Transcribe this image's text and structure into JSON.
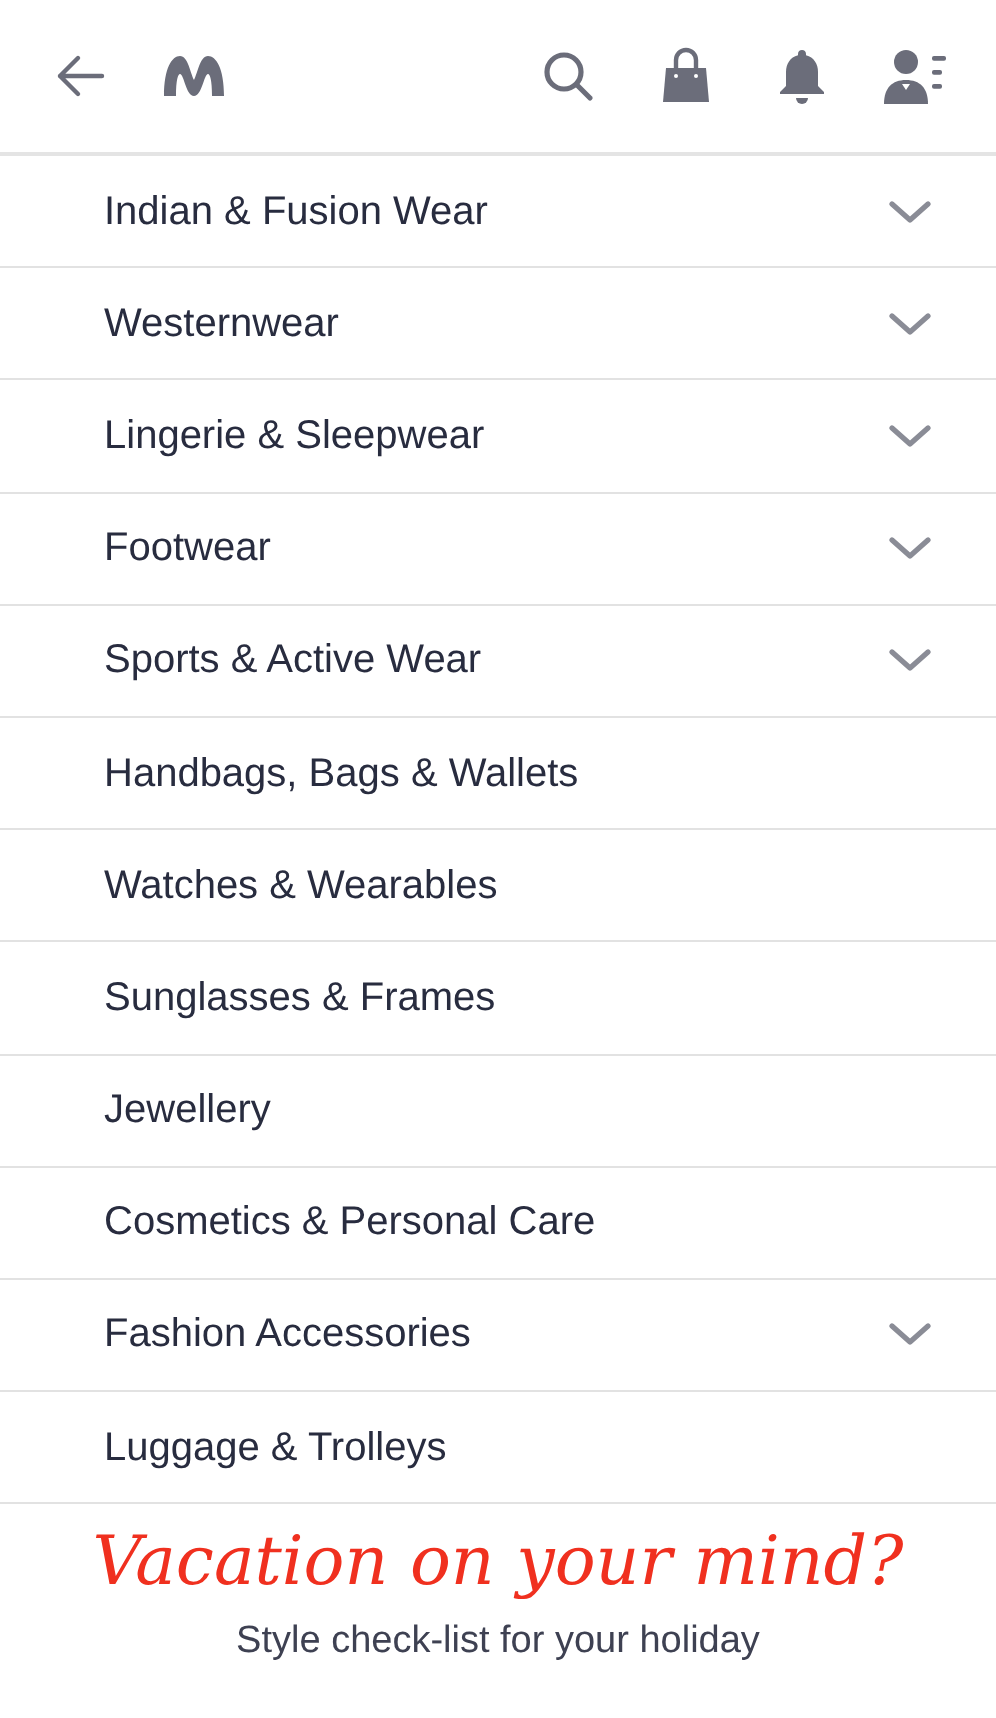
{
  "categories": [
    {
      "label": "Indian & Fusion Wear",
      "has_submenu": true
    },
    {
      "label": "Westernwear",
      "has_submenu": true
    },
    {
      "label": "Lingerie & Sleepwear",
      "has_submenu": true
    },
    {
      "label": "Footwear",
      "has_submenu": true
    },
    {
      "label": "Sports & Active Wear",
      "has_submenu": true
    },
    {
      "label": "Handbags, Bags & Wallets",
      "has_submenu": false
    },
    {
      "label": "Watches & Wearables",
      "has_submenu": false
    },
    {
      "label": "Sunglasses & Frames",
      "has_submenu": false
    },
    {
      "label": "Jewellery",
      "has_submenu": false
    },
    {
      "label": "Cosmetics & Personal Care",
      "has_submenu": false
    },
    {
      "label": "Fashion Accessories",
      "has_submenu": true
    },
    {
      "label": "Luggage & Trolleys",
      "has_submenu": false
    }
  ],
  "banner": {
    "headline": "Vacation on your mind?",
    "subtitle": "Style check-list for your holiday"
  }
}
